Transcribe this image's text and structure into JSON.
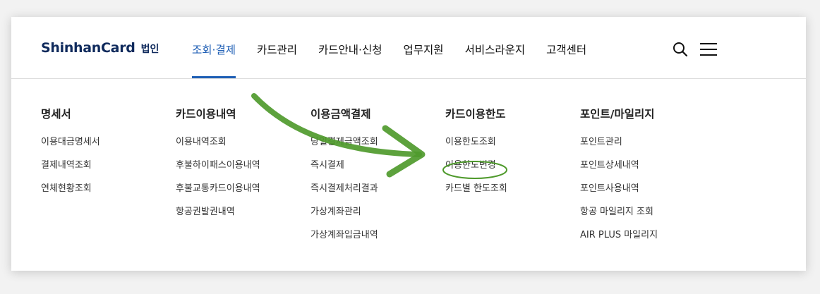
{
  "header": {
    "logo": {
      "brand": "ShinhanCard",
      "sub": "법인"
    },
    "nav": [
      {
        "label": "조회·결제",
        "active": true
      },
      {
        "label": "카드관리",
        "active": false
      },
      {
        "label": "카드안내·신청",
        "active": false
      },
      {
        "label": "업무지원",
        "active": false
      },
      {
        "label": "서비스라운지",
        "active": false
      },
      {
        "label": "고객센터",
        "active": false
      }
    ],
    "icons": [
      "search-icon",
      "menu-icon"
    ]
  },
  "menu": {
    "columns": [
      {
        "title": "명세서",
        "items": [
          "이용대금명세서",
          "결제내역조회",
          "연체현황조회"
        ]
      },
      {
        "title": "카드이용내역",
        "items": [
          "이용내역조회",
          "후불하이패스이용내역",
          "후불교통카드이용내역",
          "항공권발권내역"
        ]
      },
      {
        "title": "이용금액결제",
        "items": [
          "당일결제금액조회",
          "즉시결제",
          "즉시결제처리결과",
          "가상계좌관리",
          "가상계좌입금내역"
        ]
      },
      {
        "title": "카드이용한도",
        "items": [
          "이용한도조회",
          "이용한도변경",
          "카드별 한도조회"
        ]
      },
      {
        "title": "포인트/마일리지",
        "items": [
          "포인트관리",
          "포인트상세내역",
          "포인트사용내역",
          "항공 마일리지 조회",
          "AIR PLUS 마일리지"
        ]
      }
    ]
  },
  "colors": {
    "accent": "#1f5fb5",
    "brand": "#0f2a5c",
    "annotation": "#4f9a2c"
  }
}
